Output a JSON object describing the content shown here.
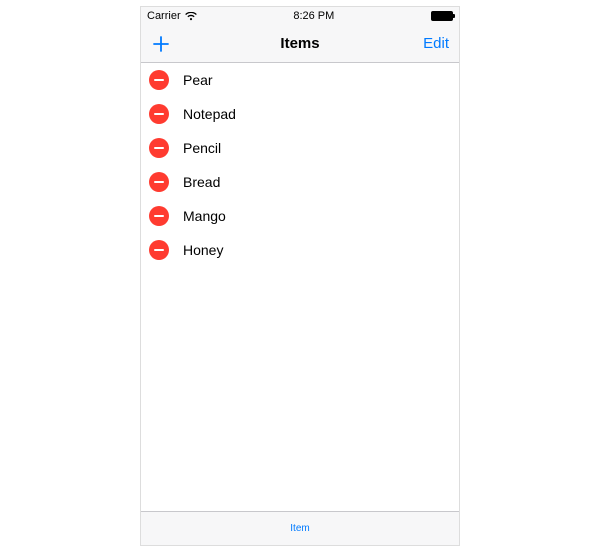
{
  "status": {
    "carrier": "Carrier",
    "time": "8:26 PM"
  },
  "nav": {
    "title": "Items",
    "edit_label": "Edit"
  },
  "list": {
    "items": [
      {
        "label": "Pear"
      },
      {
        "label": "Notepad"
      },
      {
        "label": "Pencil"
      },
      {
        "label": "Bread"
      },
      {
        "label": "Mango"
      },
      {
        "label": "Honey"
      }
    ]
  },
  "toolbar": {
    "label": "Item"
  }
}
